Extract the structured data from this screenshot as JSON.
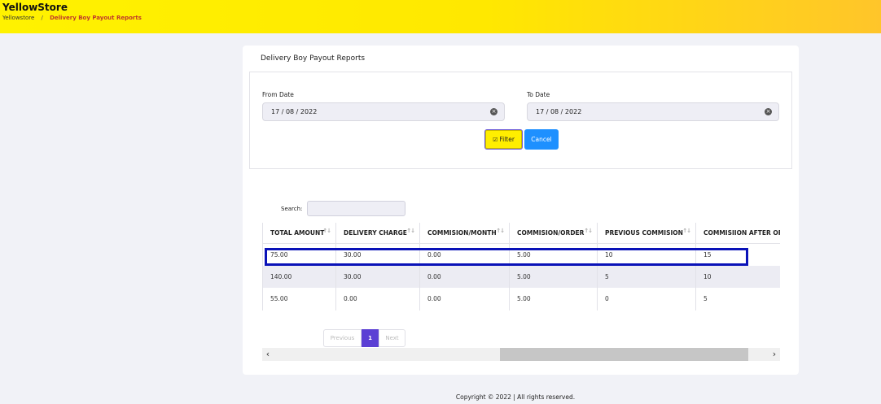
{
  "header": {
    "brand": "YellowStore",
    "breadcrumb": [
      "Yellowstore",
      "Delivery Boy Payout Reports"
    ],
    "breadcrumb_sep": "/"
  },
  "card": {
    "title": "Delivery Boy Payout Reports"
  },
  "filters": {
    "from_label": "From Date",
    "from_value": "17 / 08 / 2022",
    "to_label": "To Date",
    "to_value": "17 / 08 / 2022",
    "filter_button": "Filter",
    "cancel_button": "Cancel"
  },
  "search": {
    "label": "Search:",
    "value": ""
  },
  "table": {
    "columns": [
      "TOTAL AMOUNT",
      "DELIVERY CHARGE",
      "COMMISION/MONTH",
      "COMMISION/ORDER",
      "PREVIOUS COMMISION",
      "COMMISIION AFTER OR"
    ],
    "rows": [
      [
        "75.00",
        "30.00",
        "0.00",
        "5.00",
        "10",
        "15"
      ],
      [
        "140.00",
        "30.00",
        "0.00",
        "5.00",
        "5",
        "10"
      ],
      [
        "55.00",
        "0.00",
        "0.00",
        "5.00",
        "0",
        "5"
      ]
    ]
  },
  "pagination": {
    "previous": "Previous",
    "current": "1",
    "next": "Next"
  },
  "footer": "Copyright © 2022 | All rights reserved.",
  "colors": {
    "topbar": "#fff200",
    "accent_purple": "#5b3fd4",
    "cancel_blue": "#1e90ff",
    "highlight_box": "#0a12b8"
  }
}
